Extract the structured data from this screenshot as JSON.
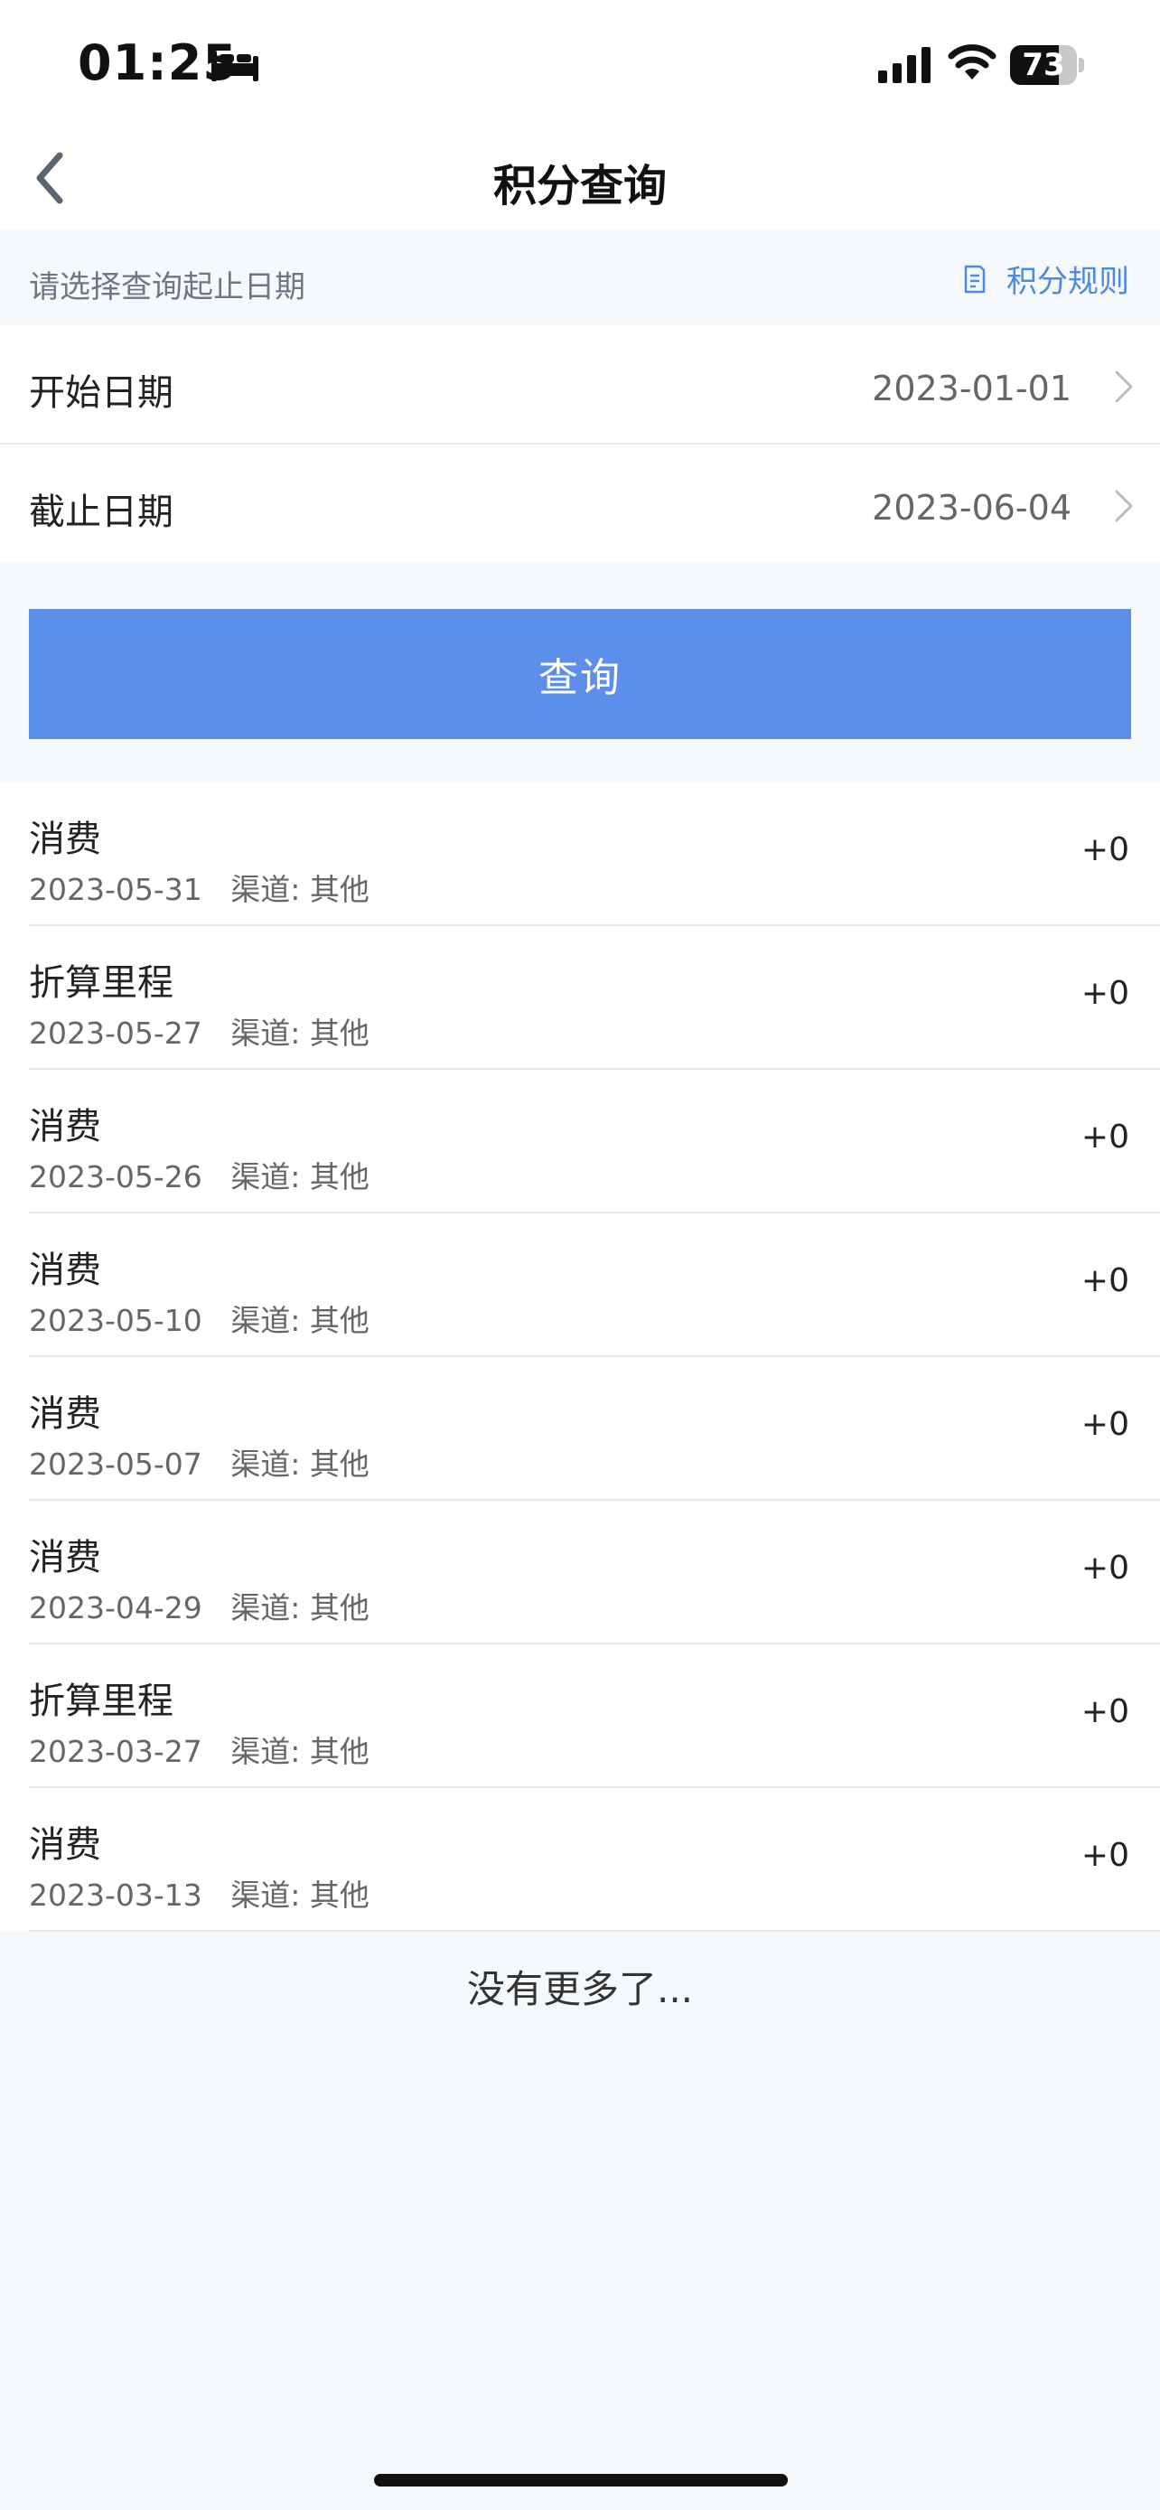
{
  "status_bar": {
    "time": "01:25",
    "battery": "73",
    "battery_fraction": 0.73
  },
  "nav": {
    "title": "积分查询"
  },
  "hint": {
    "text": "请选择查询起止日期",
    "rules_label": "积分规则"
  },
  "dates": {
    "start_label": "开始日期",
    "start_value": "2023-01-01",
    "end_label": "截止日期",
    "end_value": "2023-06-04"
  },
  "query_button": {
    "label": "查询"
  },
  "records": [
    {
      "title": "消费",
      "meta": "2023-05-31   渠道: 其他",
      "points": "+0"
    },
    {
      "title": "折算里程",
      "meta": "2023-05-27   渠道: 其他",
      "points": "+0"
    },
    {
      "title": "消费",
      "meta": "2023-05-26   渠道: 其他",
      "points": "+0"
    },
    {
      "title": "消费",
      "meta": "2023-05-10   渠道: 其他",
      "points": "+0"
    },
    {
      "title": "消费",
      "meta": "2023-05-07   渠道: 其他",
      "points": "+0"
    },
    {
      "title": "消费",
      "meta": "2023-04-29   渠道: 其他",
      "points": "+0"
    },
    {
      "title": "折算里程",
      "meta": "2023-03-27   渠道: 其他",
      "points": "+0"
    },
    {
      "title": "消费",
      "meta": "2023-03-13   渠道: 其他",
      "points": "+0"
    }
  ],
  "footer": {
    "no_more": "没有更多了..."
  },
  "colors": {
    "accent": "#5b8fe9",
    "link": "#4a8ae6",
    "background": "#f5f9fc"
  },
  "icons": [
    "bed-icon",
    "signal-icon",
    "wifi-icon",
    "battery-icon",
    "back-arrow-icon",
    "document-icon",
    "chevron-right-icon"
  ]
}
